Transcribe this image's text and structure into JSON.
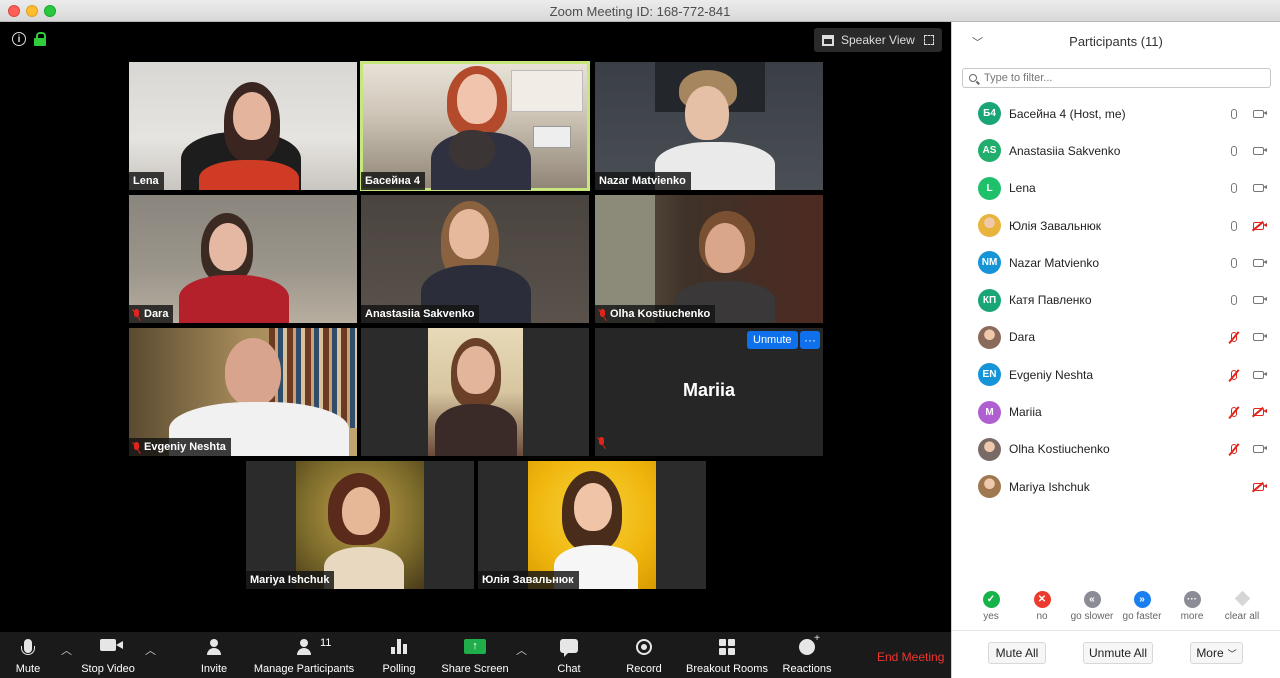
{
  "window": {
    "title": "Zoom Meeting ID: 168-772-841"
  },
  "top_bar": {
    "speaker_view_label": "Speaker View"
  },
  "tiles": [
    {
      "name": "Lena",
      "muted": false,
      "video": true
    },
    {
      "name": "Басейна 4",
      "muted": false,
      "video": true,
      "active": true
    },
    {
      "name": "Nazar Matvienko",
      "muted": false,
      "video": true
    },
    {
      "name": "Dara",
      "muted": true,
      "video": true
    },
    {
      "name": "Anastasiia Sakvenko",
      "muted": false,
      "video": true
    },
    {
      "name": "Olha Kostiuchenko",
      "muted": true,
      "video": true
    },
    {
      "name": "Evgeniy Neshta",
      "muted": true,
      "video": true
    },
    {
      "name": "",
      "muted": false,
      "video": true
    },
    {
      "name": "Mariia",
      "muted": true,
      "video": false,
      "unmute_label": "Unmute",
      "more_label": "···"
    },
    {
      "name": "Mariya Ishchuk",
      "muted": false,
      "video": true
    },
    {
      "name": "Юлія Завальнюк",
      "muted": false,
      "video": true
    }
  ],
  "toolbar": {
    "mute": "Mute",
    "stop_video": "Stop Video",
    "invite": "Invite",
    "manage_participants": "Manage Participants",
    "participant_count": "11",
    "polling": "Polling",
    "share_screen": "Share Screen",
    "chat": "Chat",
    "record": "Record",
    "breakout_rooms": "Breakout Rooms",
    "reactions": "Reactions",
    "end_meeting": "End Meeting",
    "share_arrow": "↑"
  },
  "panel": {
    "title": "Participants (11)",
    "filter_placeholder": "Type to filter...",
    "participants": [
      {
        "initials": "Б4",
        "name": "Басейна 4 (Host, me)",
        "color": "#1aa577",
        "mic_off": false,
        "cam_off": false
      },
      {
        "initials": "AS",
        "name": "Anastasiia Sakvenko",
        "color": "#21ad6b",
        "mic_off": false,
        "cam_off": false
      },
      {
        "initials": "L",
        "name": "Lena",
        "color": "#1ec16a",
        "mic_off": false,
        "cam_off": false
      },
      {
        "initials": "",
        "name": "Юлія Завальнюк",
        "color": "#e8b43c",
        "mic_off": false,
        "cam_off": true,
        "photo": true
      },
      {
        "initials": "NM",
        "name": "Nazar Matvienko",
        "color": "#1595d8",
        "mic_off": false,
        "cam_off": false
      },
      {
        "initials": "КП",
        "name": "Катя Павленко",
        "color": "#1aa577",
        "mic_off": false,
        "cam_off": false
      },
      {
        "initials": "",
        "name": "Dara",
        "color": "#8a6a5a",
        "mic_off": true,
        "cam_off": false,
        "photo": true
      },
      {
        "initials": "EN",
        "name": "Evgeniy Neshta",
        "color": "#1595d8",
        "mic_off": true,
        "cam_off": false
      },
      {
        "initials": "M",
        "name": "Mariia",
        "color": "#b05fd0",
        "mic_off": true,
        "cam_off": true
      },
      {
        "initials": "",
        "name": "Olha Kostiuchenko",
        "color": "#7a6a66",
        "mic_off": true,
        "cam_off": false,
        "photo": true
      },
      {
        "initials": "",
        "name": "Mariya Ishchuk",
        "color": "#a07850",
        "mic_off": false,
        "cam_off": true,
        "photo": true,
        "no_mic": true
      }
    ],
    "feedback": [
      {
        "label": "yes",
        "color": "#16b24a",
        "glyph": "✓"
      },
      {
        "label": "no",
        "color": "#ec3b2e",
        "glyph": "✕"
      },
      {
        "label": "go slower",
        "color": "#8c8c96",
        "glyph": "«"
      },
      {
        "label": "go faster",
        "color": "#1a7ff0",
        "glyph": "»"
      },
      {
        "label": "more",
        "color": "#8c8c96",
        "glyph": "···"
      },
      {
        "label": "clear all",
        "color": "#d6d6d6",
        "glyph": ""
      }
    ],
    "mute_all": "Mute All",
    "unmute_all": "Unmute All",
    "more": "More"
  }
}
